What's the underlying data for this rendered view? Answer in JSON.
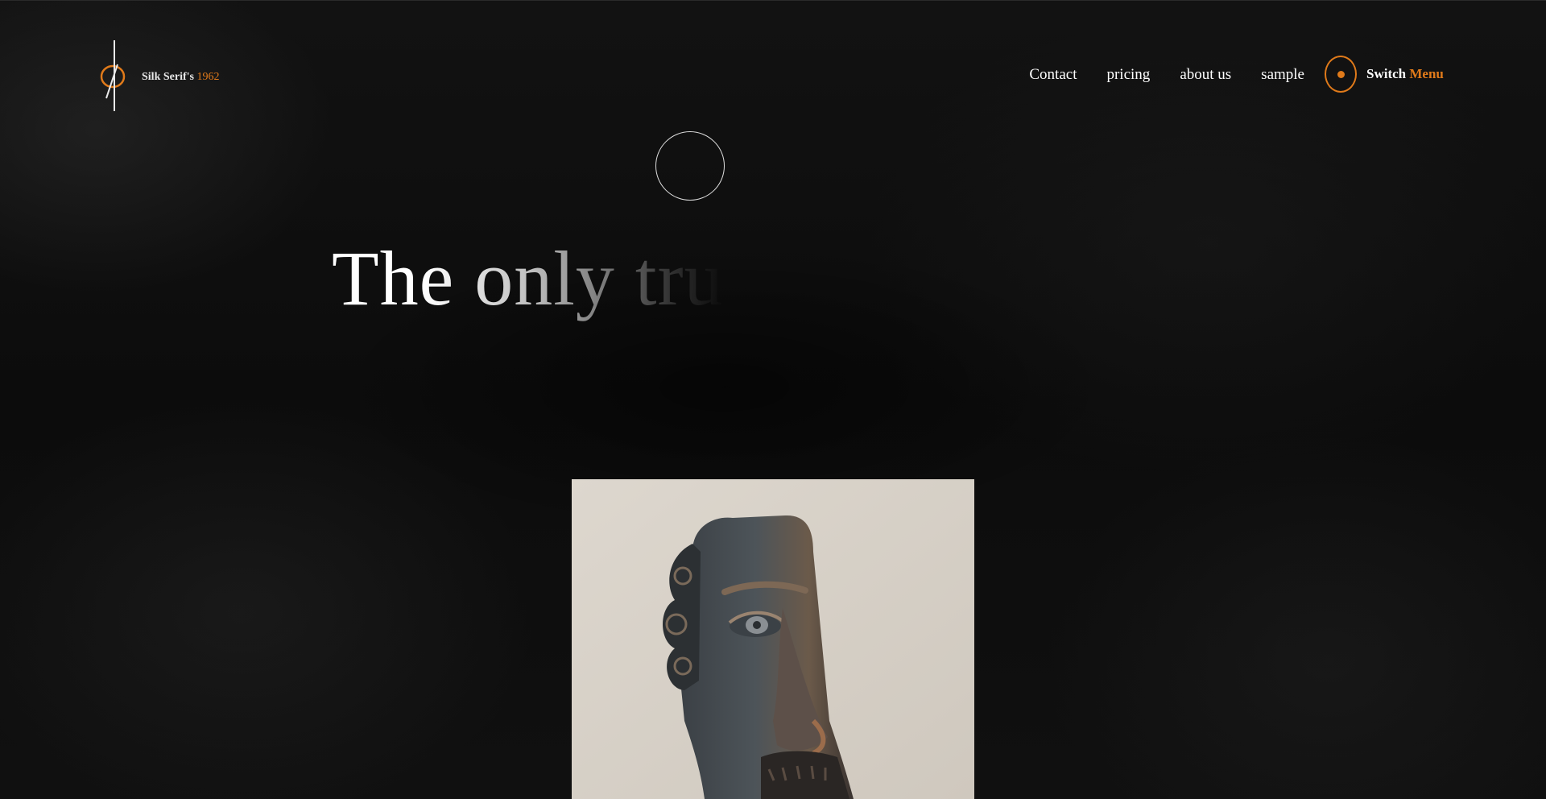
{
  "logo": {
    "name": "Silk Serif's",
    "year": "1962"
  },
  "nav": {
    "items": [
      "Contact",
      "pricing",
      "about us",
      "sample"
    ]
  },
  "switch_menu": {
    "word1": "Switch",
    "word2": "Menu"
  },
  "hero": {
    "title": "The only true w"
  },
  "colors": {
    "accent": "#e07a1a",
    "background": "#0d0d0d",
    "text": "#ffffff"
  },
  "icons": {
    "logo": "slashed-circle-logo-icon",
    "switch": "dot-in-ring-icon",
    "cursor": "cursor-ring-icon"
  }
}
